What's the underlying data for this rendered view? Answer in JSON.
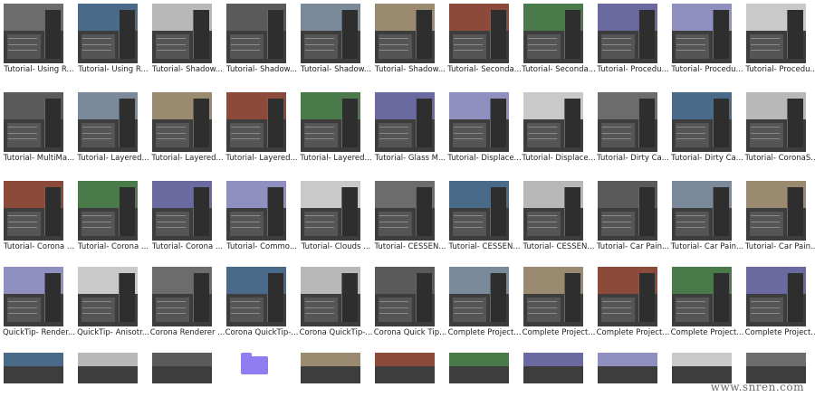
{
  "tiles": [
    [
      "Tutorial- Using R...",
      "Tutorial- Using R...",
      "Tutorial- Shadow...",
      "Tutorial- Shadow...",
      "Tutorial- Shadow...",
      "Tutorial- Shadow...",
      "Tutorial- Seconda...",
      "Tutorial- Seconda...",
      "Tutorial- Procedu...",
      "Tutorial- Procedu...",
      "Tutorial- Procedu..."
    ],
    [
      "Tutorial- MultiMa...",
      "Tutorial- Layered...",
      "Tutorial- Layered...",
      "Tutorial- Layered...",
      "Tutorial- Layered...",
      "Tutorial- Glass M...",
      "Tutorial- Displace...",
      "Tutorial- Displace...",
      "Tutorial- Dirty Ca...",
      "Tutorial- Dirty Ca...",
      "Tutorial- CoronaS..."
    ],
    [
      "Tutorial- Corona ...",
      "Tutorial- Corona ...",
      "Tutorial- Corona ...",
      "Tutorial- Commo...",
      "Tutorial- Clouds ...",
      "Tutorial- CESSEN...",
      "Tutorial- CESSEN...",
      "Tutorial- CESSEN...",
      "Tutorial- Car Pain...",
      "Tutorial- Car Pain...",
      "Tutorial- Car Pain..."
    ],
    [
      "QuickTip- Render...",
      "QuickTip- Anisotr...",
      "Corona Renderer ...",
      "Corona QuickTip-...",
      "Corona QuickTip-...",
      "Corona Quick Tip...",
      "Complete Project...",
      "Complete Project...",
      "Complete Project...",
      "Complete Project...",
      "Complete Project..."
    ]
  ],
  "bottom_row_count": 11,
  "folder_index": 3,
  "watermark": "www.snren.com",
  "colors": {
    "folder": "#8e7cf0",
    "thumb_bg": "#3d3d3d"
  }
}
